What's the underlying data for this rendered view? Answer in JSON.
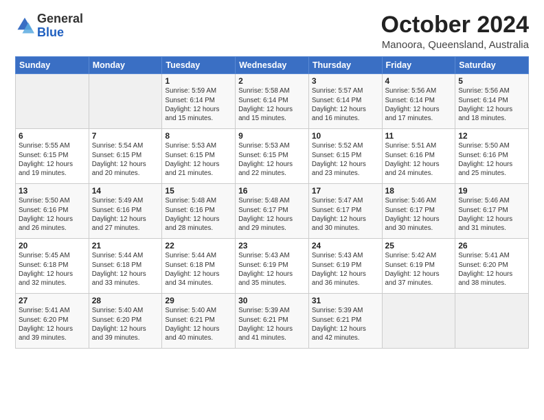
{
  "logo": {
    "general": "General",
    "blue": "Blue"
  },
  "header": {
    "month": "October 2024",
    "location": "Manoora, Queensland, Australia"
  },
  "days_of_week": [
    "Sunday",
    "Monday",
    "Tuesday",
    "Wednesday",
    "Thursday",
    "Friday",
    "Saturday"
  ],
  "weeks": [
    [
      {
        "day": "",
        "info": ""
      },
      {
        "day": "",
        "info": ""
      },
      {
        "day": "1",
        "info": "Sunrise: 5:59 AM\nSunset: 6:14 PM\nDaylight: 12 hours and 15 minutes."
      },
      {
        "day": "2",
        "info": "Sunrise: 5:58 AM\nSunset: 6:14 PM\nDaylight: 12 hours and 15 minutes."
      },
      {
        "day": "3",
        "info": "Sunrise: 5:57 AM\nSunset: 6:14 PM\nDaylight: 12 hours and 16 minutes."
      },
      {
        "day": "4",
        "info": "Sunrise: 5:56 AM\nSunset: 6:14 PM\nDaylight: 12 hours and 17 minutes."
      },
      {
        "day": "5",
        "info": "Sunrise: 5:56 AM\nSunset: 6:14 PM\nDaylight: 12 hours and 18 minutes."
      }
    ],
    [
      {
        "day": "6",
        "info": "Sunrise: 5:55 AM\nSunset: 6:15 PM\nDaylight: 12 hours and 19 minutes."
      },
      {
        "day": "7",
        "info": "Sunrise: 5:54 AM\nSunset: 6:15 PM\nDaylight: 12 hours and 20 minutes."
      },
      {
        "day": "8",
        "info": "Sunrise: 5:53 AM\nSunset: 6:15 PM\nDaylight: 12 hours and 21 minutes."
      },
      {
        "day": "9",
        "info": "Sunrise: 5:53 AM\nSunset: 6:15 PM\nDaylight: 12 hours and 22 minutes."
      },
      {
        "day": "10",
        "info": "Sunrise: 5:52 AM\nSunset: 6:15 PM\nDaylight: 12 hours and 23 minutes."
      },
      {
        "day": "11",
        "info": "Sunrise: 5:51 AM\nSunset: 6:16 PM\nDaylight: 12 hours and 24 minutes."
      },
      {
        "day": "12",
        "info": "Sunrise: 5:50 AM\nSunset: 6:16 PM\nDaylight: 12 hours and 25 minutes."
      }
    ],
    [
      {
        "day": "13",
        "info": "Sunrise: 5:50 AM\nSunset: 6:16 PM\nDaylight: 12 hours and 26 minutes."
      },
      {
        "day": "14",
        "info": "Sunrise: 5:49 AM\nSunset: 6:16 PM\nDaylight: 12 hours and 27 minutes."
      },
      {
        "day": "15",
        "info": "Sunrise: 5:48 AM\nSunset: 6:16 PM\nDaylight: 12 hours and 28 minutes."
      },
      {
        "day": "16",
        "info": "Sunrise: 5:48 AM\nSunset: 6:17 PM\nDaylight: 12 hours and 29 minutes."
      },
      {
        "day": "17",
        "info": "Sunrise: 5:47 AM\nSunset: 6:17 PM\nDaylight: 12 hours and 30 minutes."
      },
      {
        "day": "18",
        "info": "Sunrise: 5:46 AM\nSunset: 6:17 PM\nDaylight: 12 hours and 30 minutes."
      },
      {
        "day": "19",
        "info": "Sunrise: 5:46 AM\nSunset: 6:17 PM\nDaylight: 12 hours and 31 minutes."
      }
    ],
    [
      {
        "day": "20",
        "info": "Sunrise: 5:45 AM\nSunset: 6:18 PM\nDaylight: 12 hours and 32 minutes."
      },
      {
        "day": "21",
        "info": "Sunrise: 5:44 AM\nSunset: 6:18 PM\nDaylight: 12 hours and 33 minutes."
      },
      {
        "day": "22",
        "info": "Sunrise: 5:44 AM\nSunset: 6:18 PM\nDaylight: 12 hours and 34 minutes."
      },
      {
        "day": "23",
        "info": "Sunrise: 5:43 AM\nSunset: 6:19 PM\nDaylight: 12 hours and 35 minutes."
      },
      {
        "day": "24",
        "info": "Sunrise: 5:43 AM\nSunset: 6:19 PM\nDaylight: 12 hours and 36 minutes."
      },
      {
        "day": "25",
        "info": "Sunrise: 5:42 AM\nSunset: 6:19 PM\nDaylight: 12 hours and 37 minutes."
      },
      {
        "day": "26",
        "info": "Sunrise: 5:41 AM\nSunset: 6:20 PM\nDaylight: 12 hours and 38 minutes."
      }
    ],
    [
      {
        "day": "27",
        "info": "Sunrise: 5:41 AM\nSunset: 6:20 PM\nDaylight: 12 hours and 39 minutes."
      },
      {
        "day": "28",
        "info": "Sunrise: 5:40 AM\nSunset: 6:20 PM\nDaylight: 12 hours and 39 minutes."
      },
      {
        "day": "29",
        "info": "Sunrise: 5:40 AM\nSunset: 6:21 PM\nDaylight: 12 hours and 40 minutes."
      },
      {
        "day": "30",
        "info": "Sunrise: 5:39 AM\nSunset: 6:21 PM\nDaylight: 12 hours and 41 minutes."
      },
      {
        "day": "31",
        "info": "Sunrise: 5:39 AM\nSunset: 6:21 PM\nDaylight: 12 hours and 42 minutes."
      },
      {
        "day": "",
        "info": ""
      },
      {
        "day": "",
        "info": ""
      }
    ]
  ]
}
